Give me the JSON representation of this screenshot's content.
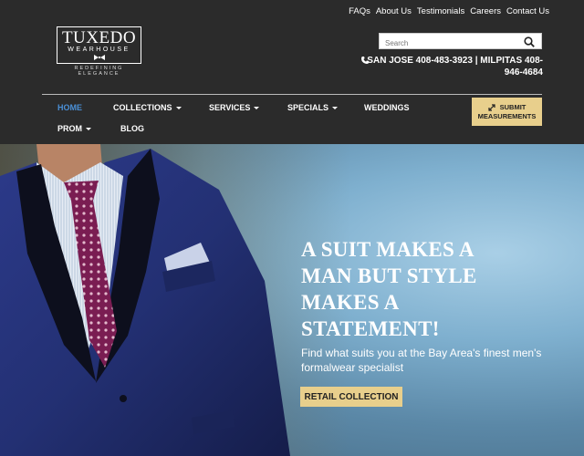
{
  "top_links": [
    "FAQs",
    "About Us",
    "Testimonials",
    "Careers",
    "Contact Us"
  ],
  "logo": {
    "main": "TUXEDO",
    "sub": "WEARHOUSE",
    "tagline": "REDEFINING ELEGANCE"
  },
  "search": {
    "placeholder": "Search",
    "icon": "search-icon"
  },
  "phone": {
    "text": "SAN JOSE 408-483-3923 | MILPITAS 408-946-4684",
    "icon": "phone-icon"
  },
  "nav": {
    "home": "HOME",
    "collections": "COLLECTIONS",
    "services": "SERVICES",
    "specials": "SPECIALS",
    "weddings": "WEDDINGS",
    "prom": "PROM",
    "blog": "BLOG"
  },
  "submit_button": {
    "line1": "SUBMIT",
    "line2": "MEASUREMENTS",
    "icon": "expand-icon"
  },
  "hero": {
    "headline_line1": "A SUIT MAKES A",
    "headline_line2": "MAN BUT STYLE",
    "headline_line3": "MAKES A",
    "headline_line4": "STATEMENT!",
    "subtext": "Find what suits you at the Bay Area's finest men's formalwear specialist",
    "button": "RETAIL COLLECTION"
  },
  "colors": {
    "header_bg": "#2b2b2b",
    "accent_gold": "#e8cf8c",
    "active_link": "#4a8fd6"
  }
}
